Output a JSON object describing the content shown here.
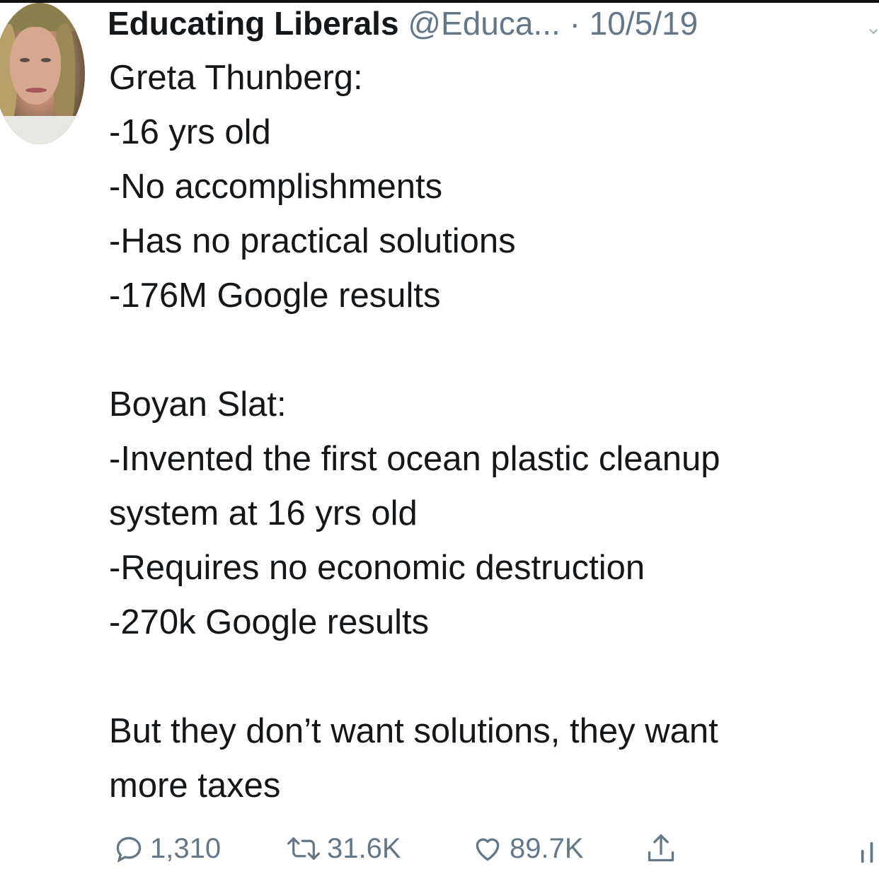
{
  "tweet": {
    "display_name": "Educating Liberals",
    "handle": "@Educa...",
    "separator": "·",
    "date": "10/5/19",
    "lines": [
      "Greta Thunberg:",
      "-16 yrs old",
      "-No accomplishments",
      "-Has no practical solutions",
      "-176M Google results",
      "",
      "Boyan Slat:",
      "-Invented the first ocean plastic cleanup",
      "system at 16 yrs old",
      "-Requires no economic destruction",
      "-270k Google results",
      "",
      "But they don’t want solutions, they want",
      "more taxes"
    ]
  },
  "actions": {
    "reply_count": "1,310",
    "retweet_count": "31.6K",
    "like_count": "89.7K"
  },
  "icons": {
    "reply": "reply-icon",
    "retweet": "retweet-icon",
    "like": "heart-icon",
    "share": "share-icon",
    "analytics": "analytics-icon",
    "more": "chevron-down-icon"
  },
  "colors": {
    "text": "#14171a",
    "secondary": "#657786"
  }
}
